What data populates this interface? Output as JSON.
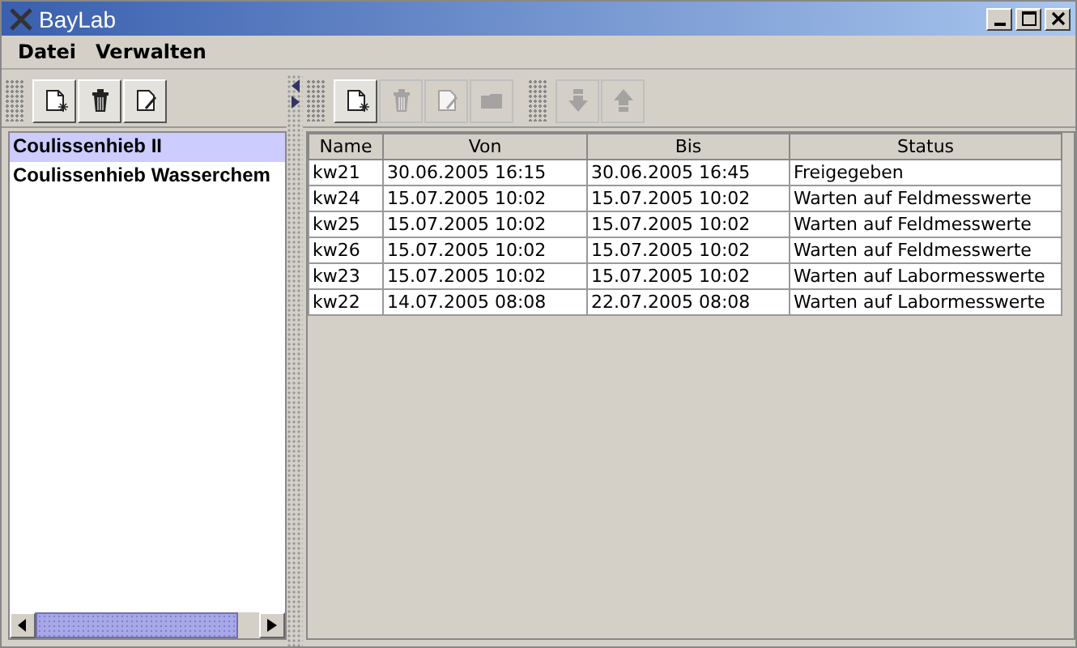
{
  "window": {
    "title": "BayLab"
  },
  "menu": [
    "Datei",
    "Verwalten"
  ],
  "left_toolbar": [
    {
      "kind": "new",
      "disabled": false
    },
    {
      "kind": "delete",
      "disabled": false
    },
    {
      "kind": "edit",
      "disabled": false
    }
  ],
  "list": [
    {
      "label": "Coulissenhieb II",
      "selected": true
    },
    {
      "label": "Coulissenhieb Wasserchem",
      "selected": false
    }
  ],
  "right_toolbar": [
    {
      "kind": "new",
      "disabled": false
    },
    {
      "kind": "delete",
      "disabled": true
    },
    {
      "kind": "edit",
      "disabled": true
    },
    {
      "kind": "folder",
      "disabled": true
    },
    {
      "kind": "separator"
    },
    {
      "kind": "down",
      "disabled": true
    },
    {
      "kind": "up",
      "disabled": true
    }
  ],
  "table": {
    "columns": [
      "Name",
      "Von",
      "Bis",
      "Status"
    ],
    "rows": [
      [
        "kw21",
        "30.06.2005 16:15",
        "30.06.2005 16:45",
        "Freigegeben"
      ],
      [
        "kw24",
        "15.07.2005 10:02",
        "15.07.2005 10:02",
        "Warten auf Feldmesswerte"
      ],
      [
        "kw25",
        "15.07.2005 10:02",
        "15.07.2005 10:02",
        "Warten auf Feldmesswerte"
      ],
      [
        "kw26",
        "15.07.2005 10:02",
        "15.07.2005 10:02",
        "Warten auf Feldmesswerte"
      ],
      [
        "kw23",
        "15.07.2005 10:02",
        "15.07.2005 10:02",
        "Warten auf Labormesswerte"
      ],
      [
        "kw22",
        "14.07.2005 08:08",
        "22.07.2005 08:08",
        "Warten auf Labormesswerte"
      ]
    ]
  }
}
